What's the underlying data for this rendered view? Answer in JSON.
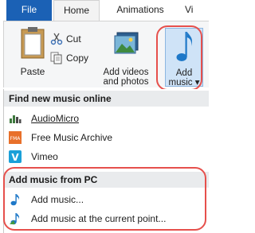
{
  "tabs": {
    "file": "File",
    "home": "Home",
    "animations": "Animations",
    "next_partial": "Vi"
  },
  "ribbon": {
    "paste": "Paste",
    "cut": "Cut",
    "copy": "Copy",
    "add_videos_line1": "Add videos",
    "add_videos_line2": "and photos",
    "add_music_line1": "Add",
    "add_music_line2": "music ▾"
  },
  "menu": {
    "online_header": "Find new music online",
    "online_items": [
      "AudioMicro",
      "Free Music Archive",
      "Vimeo"
    ],
    "pc_header": "Add music from PC",
    "pc_items": [
      "Add music...",
      "Add music at the current point..."
    ]
  },
  "colors": {
    "file_tab": "#1b61b5",
    "highlight": "#e6504c",
    "add_music_bg": "#cfe3f7"
  }
}
